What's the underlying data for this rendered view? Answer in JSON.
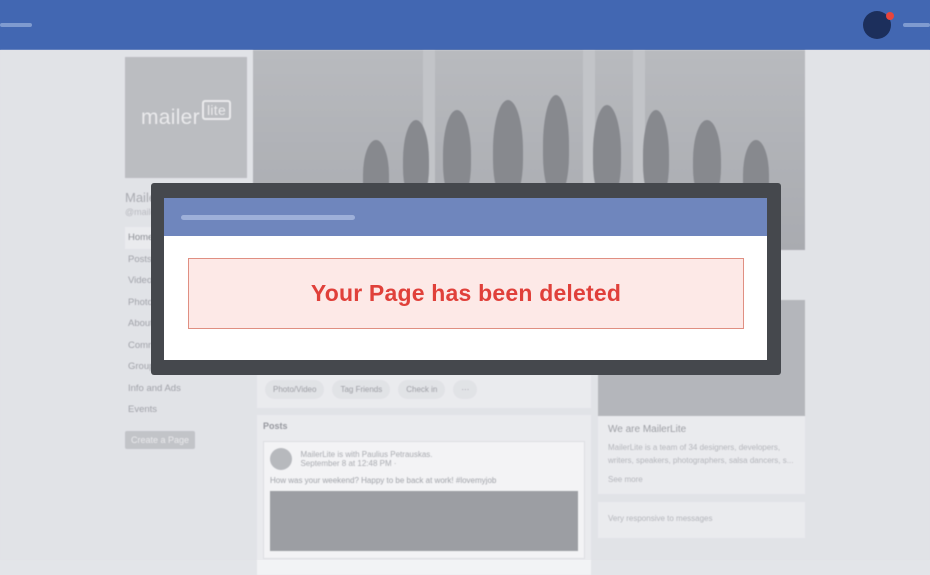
{
  "brand": {
    "logo_main": "mailer",
    "logo_badge": "lite"
  },
  "sidebar": {
    "page_name": "MailerLite",
    "handle": "@mailerlite",
    "items": [
      {
        "label": "Home",
        "active": true
      },
      {
        "label": "Posts"
      },
      {
        "label": "Videos"
      },
      {
        "label": "Photos"
      },
      {
        "label": "About"
      },
      {
        "label": "Community"
      },
      {
        "label": "Groups"
      },
      {
        "label": "Info and Ads"
      },
      {
        "label": "Events"
      }
    ],
    "create_page": "Create a Page"
  },
  "composer": {
    "actions": [
      "Photo/Video",
      "Tag Friends",
      "Check in",
      "···"
    ]
  },
  "feed": {
    "section_title": "Posts",
    "post": {
      "author": "MailerLite is with Paulius Petrauskas.",
      "date": "September 8 at 12:48 PM · ",
      "body": "How was your weekend? Happy to be back at work! #lovemyjob"
    }
  },
  "about": {
    "heading": "We are MailerLite",
    "text": "MailerLite is a team of 34 designers, developers, writers, speakers, photographers, salsa dancers, s...",
    "see_more": "See more",
    "messages_note": "Very responsive to messages"
  },
  "modal": {
    "message": "Your Page has been deleted"
  },
  "colors": {
    "topbar": "#4267b2",
    "modal_header": "#6f86bd",
    "alert_bg": "#fde9e7",
    "alert_border": "#e08f82",
    "alert_text": "#e0403a",
    "notification_dot": "#e8453c"
  }
}
